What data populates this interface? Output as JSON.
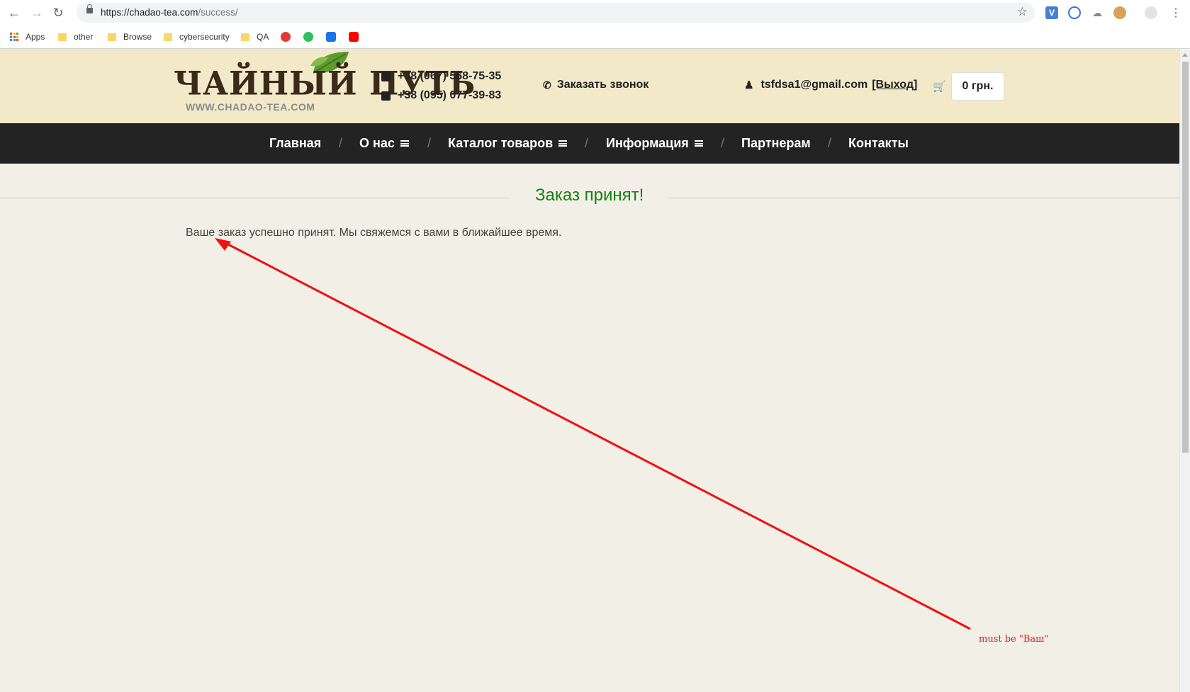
{
  "browser": {
    "url_prefix": "https://chadao-tea.com",
    "url_path": "/success/",
    "bookmarks": [
      "Apps",
      "other",
      "Browse",
      "cybersecurity",
      "QA"
    ]
  },
  "header": {
    "logo_main": "ЧАЙНЫЙ ПУТЬ",
    "logo_sub": "WWW.CHADAO-TEA.COM",
    "phones": [
      "+38 (067) 568-75-35",
      "+38 (095) 077-39-83"
    ],
    "callback": "Заказать звонок",
    "user_email": "tsfdsa1@gmail.com",
    "logout": "[Выход]",
    "cart_total": "0 грн."
  },
  "nav": {
    "items": [
      "Главная",
      "О нас",
      "Каталог товаров",
      "Информация",
      "Партнерам",
      "Контакты"
    ],
    "separator": "/"
  },
  "content": {
    "title": "Заказ принят!",
    "message": "Ваше заказ успешно принят. Мы свяжемся с вами в ближайшее время."
  },
  "annotation": {
    "text": "must be \"Ваш\"",
    "color": "#e21b1b"
  },
  "colors": {
    "header_bg": "#f2e9c9",
    "nav_bg": "#232323",
    "title_green": "#138013",
    "page_bg": "#f1efe6"
  }
}
